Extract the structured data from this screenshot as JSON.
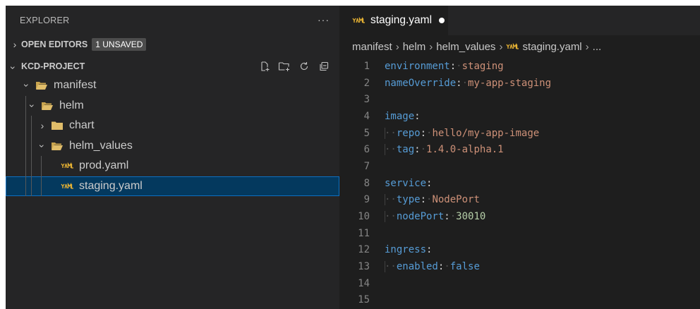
{
  "sidebar": {
    "title": "EXPLORER",
    "more_label": "···",
    "open_editors": {
      "label": "OPEN EDITORS",
      "badge": "1 UNSAVED"
    },
    "project": {
      "label": "KCD-PROJECT"
    },
    "tree": [
      {
        "label": "manifest",
        "kind": "folder-open"
      },
      {
        "label": "helm",
        "kind": "folder-open"
      },
      {
        "label": "chart",
        "kind": "folder-closed"
      },
      {
        "label": "helm_values",
        "kind": "folder-open"
      },
      {
        "label": "prod.yaml",
        "kind": "yaml-file"
      },
      {
        "label": "staging.yaml",
        "kind": "yaml-file",
        "selected": true
      }
    ]
  },
  "editor": {
    "tab": {
      "label": "staging.yaml",
      "unsaved": true
    },
    "breadcrumb": [
      "manifest",
      "helm",
      "helm_values",
      "staging.yaml",
      "..."
    ],
    "lines": [
      {
        "num": "1",
        "key": "environment",
        "value": "staging",
        "vtype": "string",
        "indent": 0
      },
      {
        "num": "2",
        "key": "nameOverride",
        "value": "my-app-staging",
        "vtype": "string",
        "indent": 0
      },
      {
        "num": "3"
      },
      {
        "num": "4",
        "key": "image",
        "indent": 0
      },
      {
        "num": "5",
        "key": "repo",
        "value": "hello/my-app-image",
        "vtype": "string",
        "indent": 1
      },
      {
        "num": "6",
        "key": "tag",
        "value": "1.4.0-alpha.1",
        "vtype": "string",
        "indent": 1
      },
      {
        "num": "7"
      },
      {
        "num": "8",
        "key": "service",
        "indent": 0
      },
      {
        "num": "9",
        "key": "type",
        "value": "NodePort",
        "vtype": "string",
        "indent": 1
      },
      {
        "num": "10",
        "key": "nodePort",
        "value": "30010",
        "vtype": "number",
        "indent": 1
      },
      {
        "num": "11"
      },
      {
        "num": "12",
        "key": "ingress",
        "indent": 0
      },
      {
        "num": "13",
        "key": "enabled",
        "value": "false",
        "vtype": "keyword",
        "indent": 1
      },
      {
        "num": "14"
      },
      {
        "num": "15"
      }
    ]
  },
  "colors": {
    "sidebar_bg": "#252526",
    "editor_bg": "#1e1e1e",
    "selection_bg": "#04395e",
    "selection_border": "#0e70c0",
    "yaml_key": "#569cd6",
    "yaml_string": "#ce9178",
    "yaml_number": "#b5cea8",
    "folder": "#e0bd6a",
    "yaml_icon": "#e5b133"
  }
}
